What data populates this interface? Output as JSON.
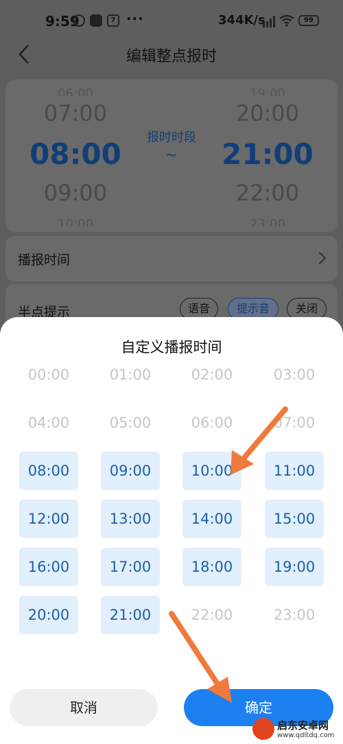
{
  "status_bar": {
    "time": "9:59",
    "notif_icons": [
      "alarm-icon",
      "wechat-icon",
      "calendar-icon"
    ],
    "calendar_day": "7",
    "more": "···",
    "net_speed": "344K/s",
    "battery": "99"
  },
  "header": {
    "title": "编辑整点报时",
    "back_icon": "chevron-left-icon"
  },
  "range_picker": {
    "label": "报时时段",
    "separator": "~",
    "start": {
      "above_edge": "06:00",
      "above": "07:00",
      "selected": "08:00",
      "below": "09:00",
      "below_edge": "10:00"
    },
    "end": {
      "above_edge": "19:00",
      "above": "20:00",
      "selected": "21:00",
      "below": "22:00",
      "below_edge": "23:00"
    }
  },
  "broadcast_time": {
    "label": "播报时间",
    "icon": "chevron-right-icon"
  },
  "half_hour": {
    "label": "半点提示",
    "options": [
      "语音",
      "提示音",
      "关闭"
    ],
    "selected": "提示音"
  },
  "sheet": {
    "title": "自定义播报时间",
    "hours": [
      {
        "label": "00:00",
        "selected": false
      },
      {
        "label": "01:00",
        "selected": false
      },
      {
        "label": "02:00",
        "selected": false
      },
      {
        "label": "03:00",
        "selected": false
      },
      {
        "label": "04:00",
        "selected": false
      },
      {
        "label": "05:00",
        "selected": false
      },
      {
        "label": "06:00",
        "selected": false
      },
      {
        "label": "07:00",
        "selected": false
      },
      {
        "label": "08:00",
        "selected": true
      },
      {
        "label": "09:00",
        "selected": true
      },
      {
        "label": "10:00",
        "selected": true
      },
      {
        "label": "11:00",
        "selected": true
      },
      {
        "label": "12:00",
        "selected": true
      },
      {
        "label": "13:00",
        "selected": true
      },
      {
        "label": "14:00",
        "selected": true
      },
      {
        "label": "15:00",
        "selected": true
      },
      {
        "label": "16:00",
        "selected": true
      },
      {
        "label": "17:00",
        "selected": true
      },
      {
        "label": "18:00",
        "selected": true
      },
      {
        "label": "19:00",
        "selected": true
      },
      {
        "label": "20:00",
        "selected": true
      },
      {
        "label": "21:00",
        "selected": true
      },
      {
        "label": "22:00",
        "selected": false
      },
      {
        "label": "23:00",
        "selected": false
      }
    ],
    "cancel_label": "取消",
    "confirm_label": "确定"
  },
  "watermark": {
    "name": "启东安卓网",
    "url": "www.qdltdq.com"
  },
  "colors": {
    "accent": "#1d80f0",
    "selected_bg": "#e2effd",
    "selected_text": "#1c5fa8",
    "arrow": "#f07a3c"
  }
}
